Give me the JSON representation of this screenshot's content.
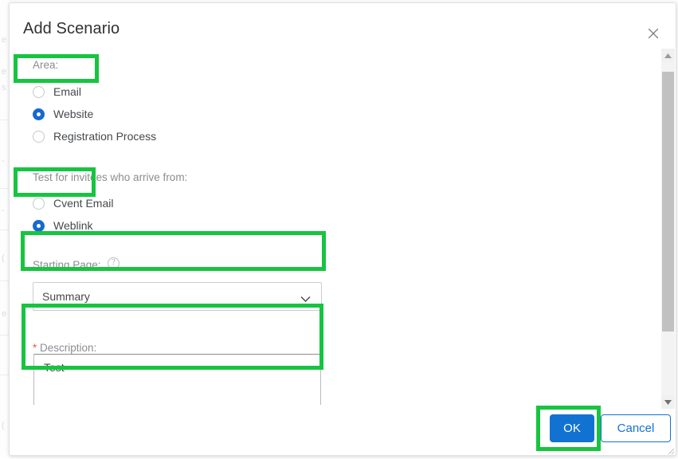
{
  "dialog": {
    "title": "Add Scenario",
    "close_icon": "close-icon"
  },
  "area_group": {
    "label": "Area:",
    "options": [
      {
        "label": "Email",
        "selected": false
      },
      {
        "label": "Website",
        "selected": true
      },
      {
        "label": "Registration Process",
        "selected": false
      }
    ]
  },
  "arrival_group": {
    "label": "Test for invitees who arrive from:",
    "options": [
      {
        "label": "Cvent Email",
        "selected": false
      },
      {
        "label": "Weblink",
        "selected": true
      }
    ]
  },
  "starting_page": {
    "label": "Starting Page:",
    "help_icon": "help-circle-icon",
    "help_glyph": "?",
    "value": "Summary",
    "options": [
      "Summary"
    ],
    "chevron_icon": "chevron-down-icon"
  },
  "description": {
    "required_marker": "*",
    "label": "Description:",
    "value": "Test",
    "placeholder": ""
  },
  "footer": {
    "ok_label": "OK",
    "cancel_label": "Cancel"
  },
  "scrollbar": {
    "up_icon": "triangle-up-icon",
    "down_icon": "triangle-down-icon",
    "thumb": "scroll-thumb"
  },
  "colors": {
    "highlight_green": "#17c440",
    "accent_blue": "#1272d1",
    "radio_blue": "#1669cf",
    "required_red": "#e8573f",
    "label_gray": "#8a8d91",
    "text_dark": "#45484c"
  },
  "background_page": {
    "ghosts": [
      "e",
      "e",
      "s",
      "|",
      "-",
      "-",
      "(",
      "e",
      "(",
      "-"
    ]
  }
}
